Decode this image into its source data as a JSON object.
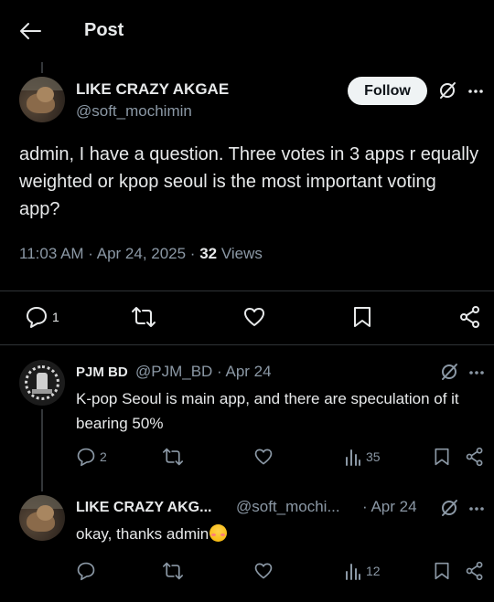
{
  "header": {
    "title": "Post"
  },
  "post": {
    "author_name": "LIKE CRAZY AKGAE",
    "author_handle": "@soft_mochimin",
    "follow_label": "Follow",
    "text": "admin, I have a question. Three votes in 3 apps r equally weighted or kpop seoul is the most important voting app?",
    "time": "11:03 AM · Apr 24, 2025 · ",
    "views_count": "32",
    "views_label": " Views",
    "reply_count": "1"
  },
  "replies": [
    {
      "author_name": "PJM BD",
      "author_handle": "@PJM_BD · Apr 24",
      "text": "K-pop Seoul is main app, and there are speculation of it bearing 50%",
      "reply_count": "2",
      "views_count": "35"
    },
    {
      "author_name": "LIKE CRAZY AKG...",
      "author_handle": "@soft_mochi...",
      "date": "· Apr 24",
      "text": "okay, thanks admin",
      "views_count": "12"
    }
  ],
  "icons": {
    "back": "arrow-left-icon",
    "grok": "grok-icon",
    "more": "more-dots-icon",
    "reply": "reply-bubble-icon",
    "repost": "repost-icon",
    "like": "heart-icon",
    "bookmark": "bookmark-icon",
    "share": "share-icon",
    "views": "views-chart-icon",
    "emoji": "blushing-face-emoji"
  },
  "colors": {
    "background": "#000000",
    "text_primary": "#e7e9ea",
    "text_secondary": "#8b98a5",
    "divider": "#2f3336",
    "follow_bg": "#eff3f4"
  }
}
